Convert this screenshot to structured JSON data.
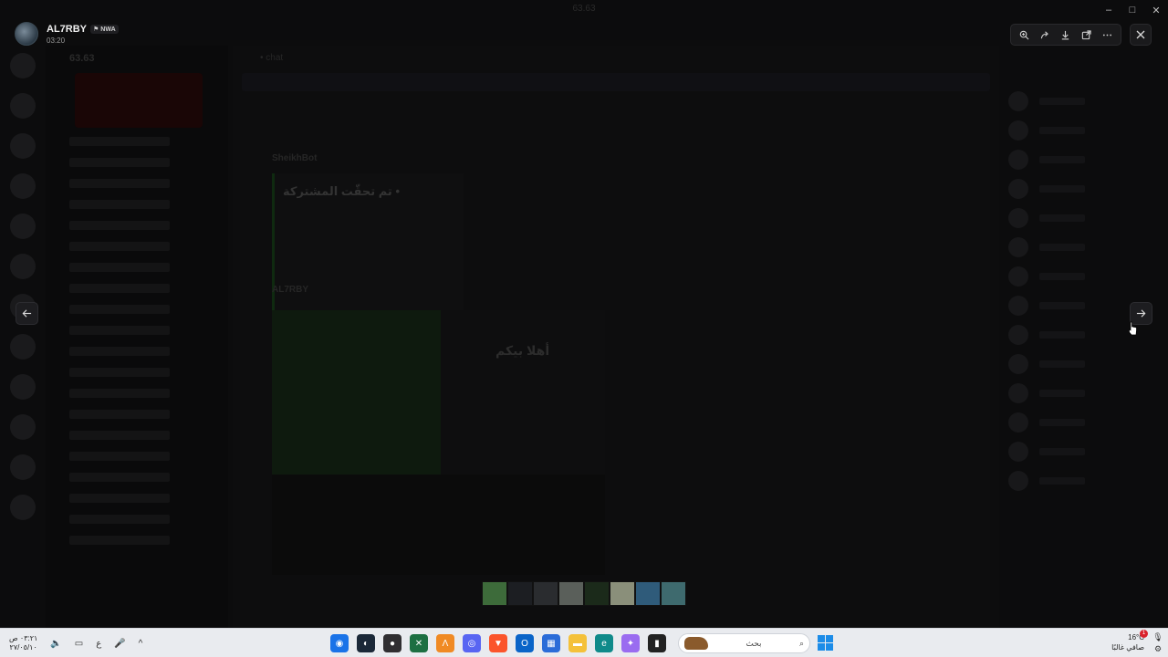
{
  "window": {
    "title": "63.63",
    "controls": [
      "–",
      "□",
      "✕"
    ]
  },
  "viewer": {
    "uploader_name": "AL7RBY",
    "uploader_tag": "NWA",
    "timestamp": "03:20",
    "toolbar": {
      "zoom_icon": "zoom-in-icon",
      "forward_icon": "forward-icon",
      "download_icon": "download-icon",
      "open_icon": "open-external-icon",
      "more_icon": "more-icon"
    },
    "close_icon": "close-icon",
    "prev_icon": "arrow-left-icon",
    "next_icon": "arrow-right-icon",
    "thumbnails": [
      {
        "color": "#3d6b3a"
      },
      {
        "color": "#1c1e22"
      },
      {
        "color": "#2a2c2f"
      },
      {
        "color": "#5a5f5a"
      },
      {
        "color": "#1b2a1a"
      },
      {
        "color": "#8a8f7a"
      },
      {
        "color": "#2f5b7a"
      },
      {
        "color": "#3e6a6e"
      }
    ]
  },
  "background": {
    "server_name": "63.63",
    "channel_header": "• chat",
    "embed_title": "تم تحقّت المشتركة •",
    "image_text": "أهلا بيكم",
    "author_line": "AL7RBY",
    "bot_name": "SheikhBot"
  },
  "taskbar": {
    "clock_time": "٠٣:٢١ ص",
    "clock_date": "٢٧/٠٥/١٠",
    "lang": "ع",
    "search_placeholder": "بحث",
    "weather_temp": "16°C",
    "weather_desc": "صافي غالبًا",
    "notification_count": "1",
    "apps": [
      {
        "name": "chrome-icon",
        "color": "#1a73e8",
        "glyph": "◉"
      },
      {
        "name": "steam-icon",
        "color": "#1b2838",
        "glyph": "◐"
      },
      {
        "name": "obs-icon",
        "color": "#302e31",
        "glyph": "●"
      },
      {
        "name": "excel-icon",
        "color": "#1d6f42",
        "glyph": "✕"
      },
      {
        "name": "app-a-icon",
        "color": "#f08a24",
        "glyph": "Λ"
      },
      {
        "name": "discord-icon",
        "color": "#5865f2",
        "glyph": "◎"
      },
      {
        "name": "brave-icon",
        "color": "#fb542b",
        "glyph": "▼"
      },
      {
        "name": "outlook-icon",
        "color": "#0a64c8",
        "glyph": "O"
      },
      {
        "name": "store-icon",
        "color": "#2b6cd8",
        "glyph": "▦"
      },
      {
        "name": "folder-icon",
        "color": "#f4c13a",
        "glyph": "▬"
      },
      {
        "name": "edge-icon",
        "color": "#0f8a8a",
        "glyph": "e"
      },
      {
        "name": "copilot-icon",
        "color": "#9a6cf0",
        "glyph": "✦"
      },
      {
        "name": "terminal-icon",
        "color": "#222",
        "glyph": "▮"
      }
    ]
  }
}
